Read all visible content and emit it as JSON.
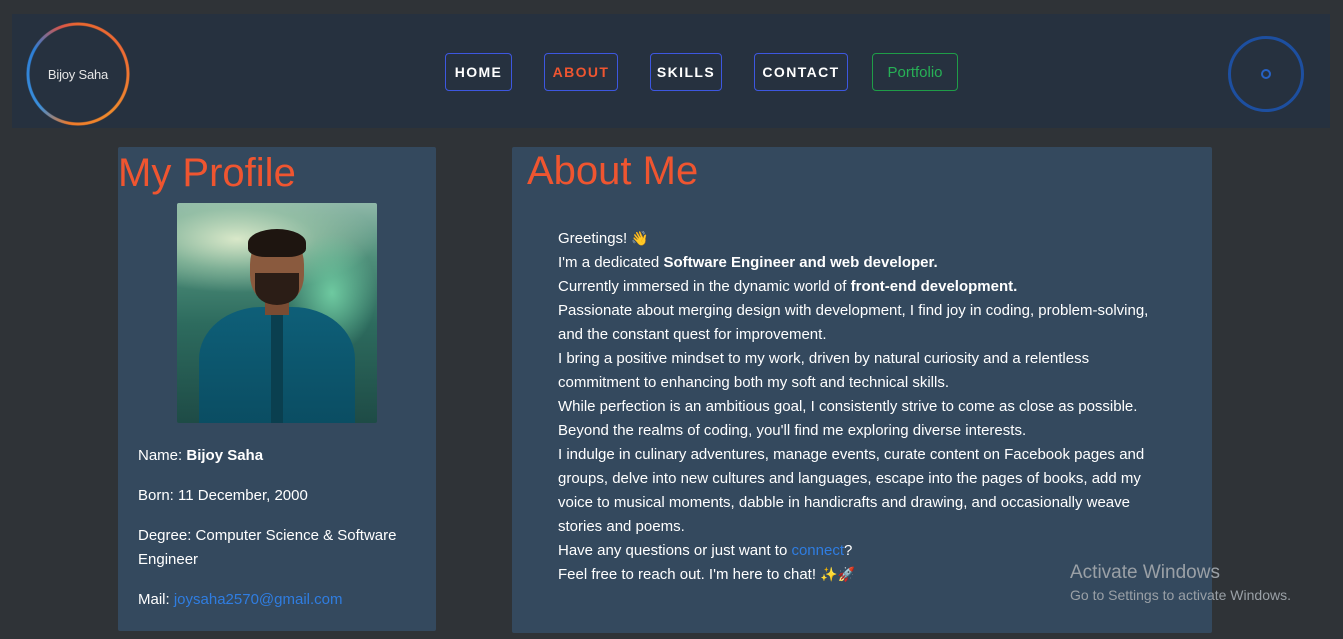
{
  "brand": {
    "name": "Bijoy Saha"
  },
  "nav": {
    "items": [
      {
        "label": "HOME",
        "active": false
      },
      {
        "label": "ABOUT",
        "active": true
      },
      {
        "label": "SKILLS",
        "active": false
      },
      {
        "label": "CONTACT",
        "active": false
      },
      {
        "label": "Portfolio",
        "active": false
      }
    ],
    "theme_toggle_icon": "circle-icon"
  },
  "profile": {
    "title": "My Profile",
    "name_label": "Name:",
    "name_value": "Bijoy Saha",
    "born_label": "Born:",
    "born_value": "11 December, 2000",
    "degree_label": "Degree:",
    "degree_value": "Computer Science & Software Engineer",
    "mail_label": "Mail:",
    "mail_value": "joysaha2570@gmail.com"
  },
  "about": {
    "title": "About Me",
    "greeting": "Greetings!",
    "greeting_emoji": "👋",
    "line2_pre": "I'm a dedicated ",
    "line2_bold": "Software Engineer and web developer.",
    "line3_pre": "Currently immersed in the dynamic world of ",
    "line3_bold": "front-end development.",
    "line4": "Passionate about merging design with development, I find joy in coding, problem-solving, and the constant quest for improvement.",
    "line5": "I bring a positive mindset to my work, driven by natural curiosity and a relentless commitment to enhancing both my soft and technical skills.",
    "line6": "While perfection is an ambitious goal, I consistently strive to come as close as possible.",
    "line7": "Beyond the realms of coding, you'll find me exploring diverse interests.",
    "line8": "I indulge in culinary adventures, manage events, curate content on Facebook pages and groups, delve into new cultures and languages, escape into the pages of books, add my voice to musical moments, dabble in handicrafts and drawing, and occasionally weave stories and poems.",
    "line9_pre": "Have any questions or just want to ",
    "line9_link": "connect",
    "line9_post": "?",
    "line10": "Feel free to reach out. I'm here to chat!",
    "line10_emoji": "✨🚀"
  },
  "watermark": {
    "title": "Activate Windows",
    "subtitle": "Go to Settings to activate Windows."
  },
  "colors": {
    "accent": "#ef5530",
    "nav_border": "#3d57e0",
    "portfolio_green": "#27b056",
    "link": "#2f7de1",
    "card_bg": "#34495e",
    "navbar_bg": "#26313f",
    "page_bg": "#2f3337"
  }
}
